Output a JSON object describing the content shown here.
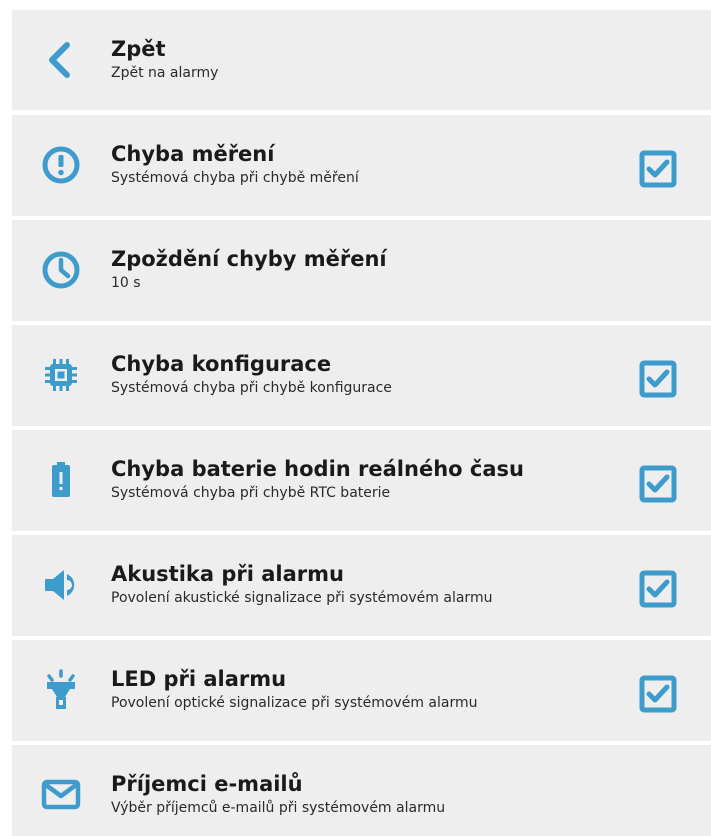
{
  "accent": "#3e9ccd",
  "items": [
    {
      "icon": "chevron-left-icon",
      "title": "Zpět",
      "subtitle": "Zpět na alarmy"
    },
    {
      "icon": "exclamation-circle-icon",
      "title": "Chyba měření",
      "subtitle": "Systémová chyba při chybě měření",
      "checked": true
    },
    {
      "icon": "clock-icon",
      "title": "Zpoždění chyby měření",
      "subtitle": "10 s"
    },
    {
      "icon": "chip-icon",
      "title": "Chyba konfigurace",
      "subtitle": "Systémová chyba při chybě konfigurace",
      "checked": true
    },
    {
      "icon": "battery-alert-icon",
      "title": "Chyba baterie hodin reálného času",
      "subtitle": "Systémová chyba při chybě RTC baterie",
      "checked": true
    },
    {
      "icon": "speaker-icon",
      "title": "Akustika při alarmu",
      "subtitle": "Povolení akustické signalizace při systémovém alarmu",
      "checked": true
    },
    {
      "icon": "led-light-icon",
      "title": "LED při alarmu",
      "subtitle": "Povolení optické signalizace při systémovém alarmu",
      "checked": true
    },
    {
      "icon": "envelope-icon",
      "title": "Příjemci e-mailů",
      "subtitle": "Výběr příjemců e-mailů při systémovém alarmu"
    }
  ]
}
